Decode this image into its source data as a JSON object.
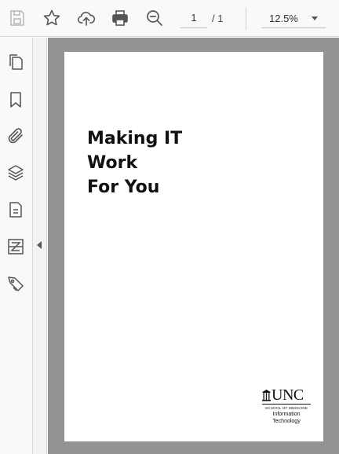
{
  "toolbar": {
    "icons": {
      "save": "save-icon",
      "bookmark": "star-icon",
      "upload": "cloud-upload-icon",
      "print": "printer-icon",
      "search": "zoom-search-icon"
    },
    "page_number": "1",
    "page_total": "/ 1",
    "zoom": "12.5%"
  },
  "sidebar": {
    "items": [
      {
        "icon": "pages-icon"
      },
      {
        "icon": "bookmark-icon"
      },
      {
        "icon": "attachment-icon"
      },
      {
        "icon": "layers-icon"
      },
      {
        "icon": "document-icon"
      },
      {
        "icon": "compare-icon"
      },
      {
        "icon": "tag-icon"
      }
    ]
  },
  "document": {
    "title_lines": [
      "Making IT",
      "Work",
      "For You"
    ],
    "logo": {
      "brand": "UNC",
      "school": "SCHOOL OF MEDICINE",
      "department_line1": "Information",
      "department_line2": "Technology"
    }
  },
  "colors": {
    "viewer_background": "#939393",
    "chrome_background": "#f9f9f9",
    "icon_color": "#555555"
  }
}
